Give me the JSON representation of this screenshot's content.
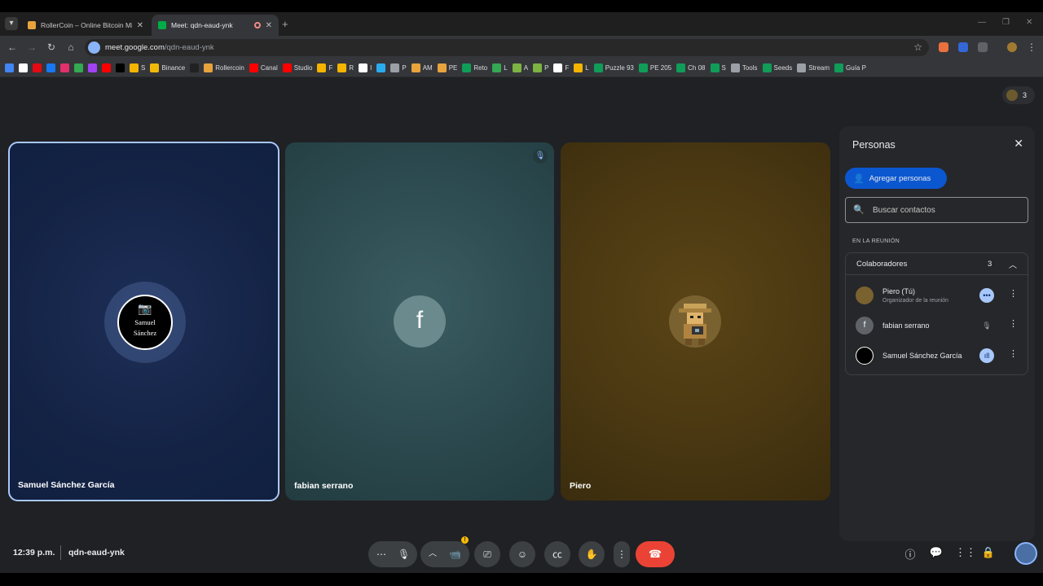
{
  "browser": {
    "tabs": [
      {
        "title": "RollerCoin – Online Bitcoin Mi",
        "active": false
      },
      {
        "title": "Meet: qdn-eaud-ynk",
        "active": true
      }
    ],
    "url_host": "meet.google.com",
    "url_path": "/qdn-eaud-ynk",
    "new_tab": "+",
    "bookmarks": [
      {
        "label": "",
        "color": "#4285f4"
      },
      {
        "label": "",
        "color": "#ffffff"
      },
      {
        "label": "",
        "color": "#e50914"
      },
      {
        "label": "",
        "color": "#1877f2"
      },
      {
        "label": "",
        "color": "#e1306c"
      },
      {
        "label": "",
        "color": "#34a853"
      },
      {
        "label": "",
        "color": "#a142f4"
      },
      {
        "label": "",
        "color": "#ff0000"
      },
      {
        "label": "",
        "color": "#000000"
      },
      {
        "label": "S",
        "color": "#f4b400"
      },
      {
        "label": "Binance",
        "color": "#f0b90b"
      },
      {
        "label": "",
        "color": "#222222"
      },
      {
        "label": "Rollercoin",
        "color": "#e8a33d"
      },
      {
        "label": "Canal",
        "color": "#ff0000"
      },
      {
        "label": "Studio",
        "color": "#ff0000"
      },
      {
        "label": "F",
        "color": "#f4b400"
      },
      {
        "label": "R",
        "color": "#f4b400"
      },
      {
        "label": "I",
        "color": "#ffffff"
      },
      {
        "label": "",
        "color": "#2aabee"
      },
      {
        "label": "P",
        "color": "#9aa0a6"
      },
      {
        "label": "AM",
        "color": "#e8a33d"
      },
      {
        "label": "PE",
        "color": "#e8a33d"
      },
      {
        "label": "Reto",
        "color": "#0f9d58"
      },
      {
        "label": "L",
        "color": "#34a853"
      },
      {
        "label": "A",
        "color": "#7cb342"
      },
      {
        "label": "P",
        "color": "#7cb342"
      },
      {
        "label": "F",
        "color": "#ffffff"
      },
      {
        "label": "L",
        "color": "#f4b400"
      },
      {
        "label": "Puzzle 93",
        "color": "#0f9d58"
      },
      {
        "label": "PE 205",
        "color": "#0f9d58"
      },
      {
        "label": "Ch 08",
        "color": "#0f9d58"
      },
      {
        "label": "S",
        "color": "#0f9d58"
      },
      {
        "label": "Tools",
        "color": "#9aa0a6"
      },
      {
        "label": "Seeds",
        "color": "#0f9d58"
      },
      {
        "label": "Stream",
        "color": "#9aa0a6"
      },
      {
        "label": "Guía P",
        "color": "#0f9d58"
      }
    ]
  },
  "meet": {
    "participant_count": "3",
    "tiles": [
      {
        "name": "Samuel Sánchez García",
        "logo_line1": "Samuel",
        "logo_line2": "Sánchez"
      },
      {
        "name": "fabian serrano",
        "initial": "f"
      },
      {
        "name": "Piero"
      }
    ],
    "panel": {
      "title": "Personas",
      "add_button": "Agregar personas",
      "search_placeholder": "Buscar contactos",
      "section_label": "EN LA REUNIÓN",
      "group_title": "Colaboradores",
      "group_count": "3",
      "people": [
        {
          "name": "Piero (Tú)",
          "subtitle": "Organizador de la reunión",
          "initial": ""
        },
        {
          "name": "fabian serrano",
          "subtitle": "",
          "initial": "f"
        },
        {
          "name": "Samuel Sánchez García",
          "subtitle": "",
          "initial": ""
        }
      ]
    },
    "bottom": {
      "time": "12:39 p.m.",
      "meeting_code": "qdn-eaud-ynk",
      "warning": "!"
    }
  }
}
